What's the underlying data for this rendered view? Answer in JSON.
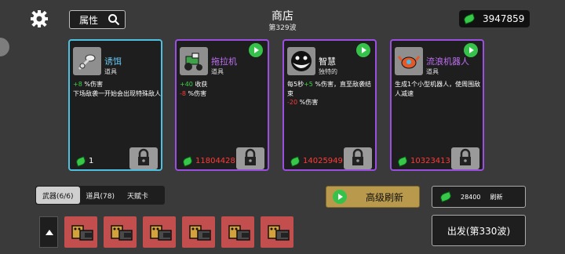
{
  "header": {
    "search_label": "属性",
    "title": "商店",
    "wave": "第329波",
    "currency": "3947859"
  },
  "cards": [
    {
      "name": "诱饵",
      "type": "道具",
      "line1_val": "+8",
      "line1_text": " %伤害",
      "line2": "下场敌袭一开始会出现特殊敌人",
      "price": "1",
      "border": "#4ec0e0"
    },
    {
      "name": "拖拉机",
      "type": "道具",
      "line1_val": "+40",
      "line1_text": " 收获",
      "line2_val": "-8",
      "line2_text": " %伤害",
      "price": "11804428",
      "border": "#9a4fe0"
    },
    {
      "name": "智慧",
      "type": "独特的",
      "line1_pre": "每5秒",
      "line1_val": "+5",
      "line1_text": " %伤害，直至敌袭结束",
      "line2_val": "-20",
      "line2_text": " %伤害",
      "price": "14025949",
      "border": "#9a4fe0"
    },
    {
      "name": "流浪机器人",
      "type": "道具",
      "line1": "生成1个小型机器人，使周围敌人减速",
      "price": "10323413",
      "border": "#9a4fe0"
    }
  ],
  "tabs": [
    "武器(6/6)",
    "道具(78)",
    "天赋卡"
  ],
  "refresh": {
    "advanced_label": "高级刷新",
    "cost": "28400",
    "cost_label": "刷新"
  },
  "depart_label": "出发(第330波)",
  "weapon_slots": 6,
  "icons": [
    "gear-icon",
    "search-icon",
    "leaf-currency-icon",
    "lock-icon",
    "play-icon",
    "up-arrow-icon",
    "gatling-gun-icon"
  ]
}
